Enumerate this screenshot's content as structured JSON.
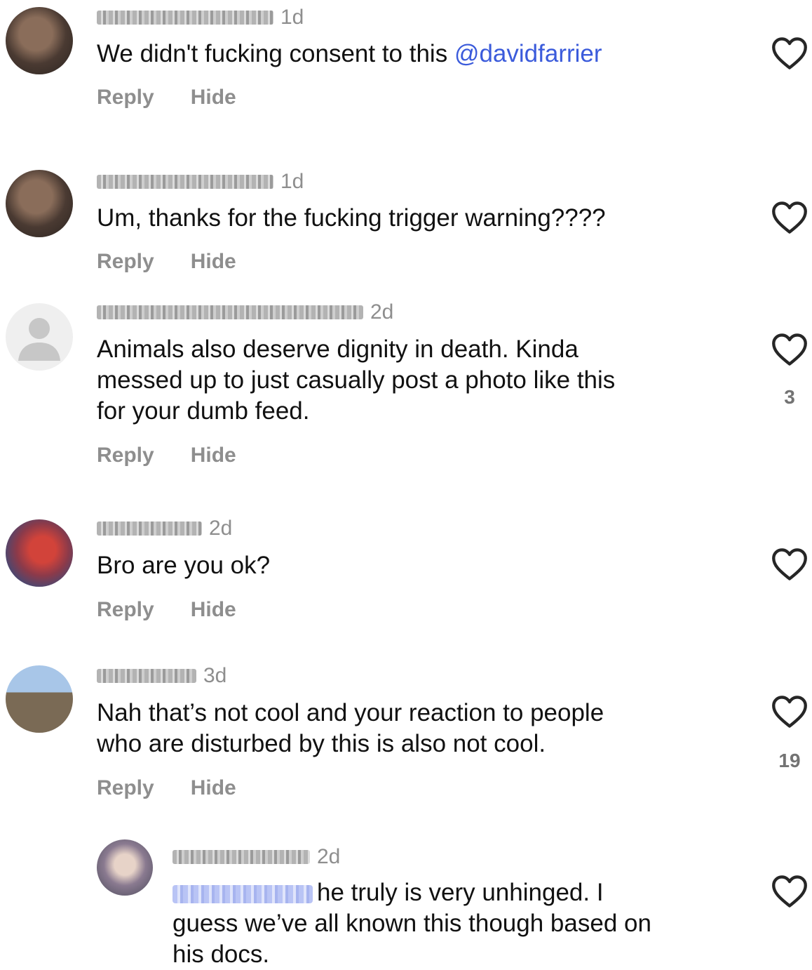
{
  "actions": {
    "reply": "Reply",
    "hide": "Hide"
  },
  "comments": [
    {
      "time": "1d",
      "text": "We didn't fucking consent to this ",
      "mention": "@davidfarrier",
      "likes": ""
    },
    {
      "time": "1d",
      "text": "Um, thanks for the fucking trigger warning????",
      "likes": ""
    },
    {
      "time": "2d",
      "lines": [
        "Animals also deserve dignity in death. Kinda",
        "messed up to just casually post a photo like this",
        "for your dumb feed."
      ],
      "likes": "3"
    },
    {
      "time": "2d",
      "text": "Bro are you ok?",
      "likes": ""
    },
    {
      "time": "3d",
      "lines": [
        "Nah that’s not cool and your reaction to people",
        "who are disturbed by this is also not cool."
      ],
      "likes": "19"
    }
  ],
  "reply": {
    "time": "2d",
    "lines": [
      "he truly is very unhinged. I",
      "guess we’ve all known this though based on",
      "his docs."
    ]
  },
  "colors": {
    "link": "#3b5bdb",
    "meta": "#8e8e8e",
    "text": "#111111"
  },
  "icons": {
    "like": "heart-outline-icon"
  }
}
